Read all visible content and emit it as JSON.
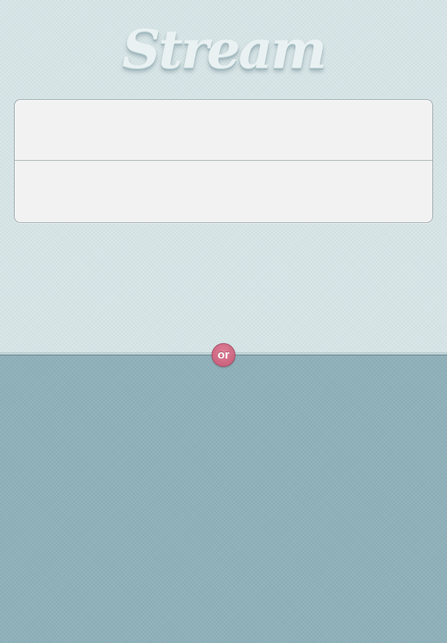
{
  "app": {
    "logo_text": "Stream"
  },
  "login_form": {
    "username_placeholder": "",
    "username_value": "",
    "password_placeholder": "",
    "password_value": ""
  },
  "divider": {
    "or_label": "or"
  },
  "colors": {
    "top_background": "#d5e3e5",
    "bottom_background": "#8fb0b9",
    "or_badge": "#cc6580",
    "card_background": "#f2f2f2"
  }
}
